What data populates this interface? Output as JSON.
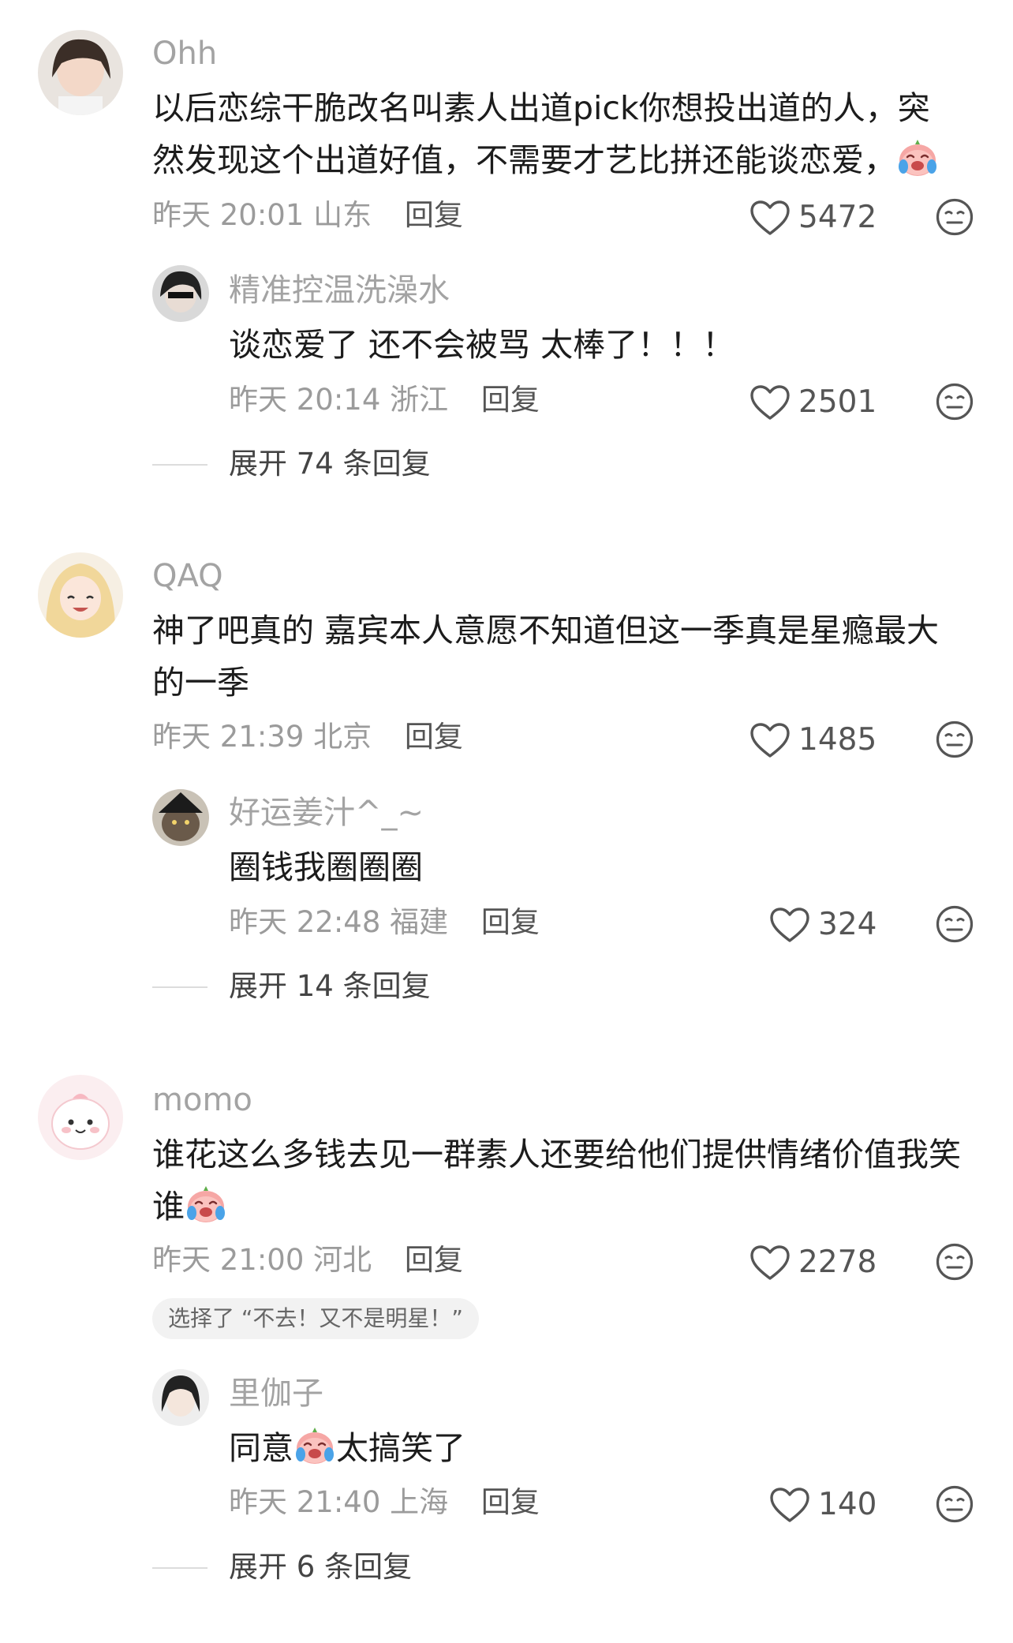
{
  "comments": [
    {
      "username": "Ohh",
      "text_lines": [
        "以后恋综干脆改名叫素人出道pick你想投出道的人，突",
        "然发现这个出道好值，不需要才艺比拼还能谈恋爱，"
      ],
      "time": "昨天 20:01",
      "location": "山东",
      "reply_label": "回复",
      "likes": "5472",
      "reply": {
        "username": "精准控温洗澡水",
        "text": "谈恋爱了 还不会被骂 太棒了！！！",
        "time": "昨天 20:14",
        "location": "浙江",
        "reply_label": "回复",
        "likes": "2501"
      },
      "expand_label": "展开 74 条回复"
    },
    {
      "username": "QAQ",
      "text_lines": [
        "神了吧真的 嘉宾本人意愿不知道但这一季真是星瘾最大",
        "的一季"
      ],
      "time": "昨天 21:39",
      "location": "北京",
      "reply_label": "回复",
      "likes": "1485",
      "reply": {
        "username": "好运姜汁^_~",
        "text": "圈钱我圈圈圈",
        "time": "昨天 22:48",
        "location": "福建",
        "reply_label": "回复",
        "likes": "324"
      },
      "expand_label": "展开 14 条回复"
    },
    {
      "username": "momo",
      "text_lines": [
        "谁花这么多钱去见一群素人还要给他们提供情绪价值我笑",
        "谁"
      ],
      "time": "昨天 21:00",
      "location": "河北",
      "reply_label": "回复",
      "likes": "2278",
      "vote_pill": "选择了 “不去！又不是明星！”",
      "reply": {
        "username": "里伽子",
        "text_before_emoji": "同意",
        "text_after_emoji": "太搞笑了",
        "time": "昨天 21:40",
        "location": "上海",
        "reply_label": "回复",
        "likes": "140"
      },
      "expand_label": "展开 6 条回复"
    }
  ],
  "icons": {
    "like": "heart-outline-icon",
    "dislike": "meh-face-icon",
    "emoji": "crying-laughing-emoji-icon"
  }
}
